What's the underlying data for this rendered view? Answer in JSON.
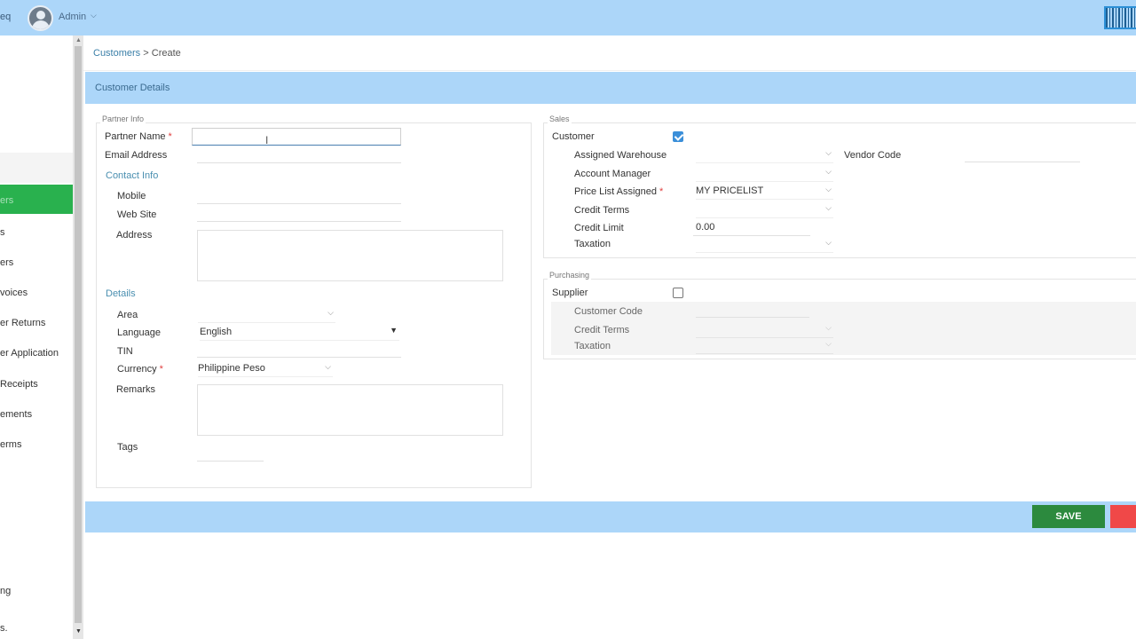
{
  "topbar": {
    "brand_fragment": "eq",
    "user": "Admin",
    "chevron": "⌵"
  },
  "sidebar": {
    "items": [
      {
        "label": "ers",
        "active": true
      },
      {
        "label": "s"
      },
      {
        "label": "ers"
      },
      {
        "label": "voices"
      },
      {
        "label": "er Returns"
      },
      {
        "label": "er Application"
      },
      {
        "label": " Receipts"
      },
      {
        "label": "ements"
      },
      {
        "label": "erms"
      },
      {
        "label": "ng"
      },
      {
        "label": "s."
      }
    ]
  },
  "breadcrumb": {
    "parent": "Customers",
    "separator": ">",
    "current": "Create"
  },
  "panel": {
    "title": "Customer Details"
  },
  "partner_info": {
    "legend": "Partner Info",
    "partner_name": {
      "label": "Partner Name",
      "required": "*",
      "value": ""
    },
    "email": {
      "label": "Email Address",
      "value": ""
    },
    "contact_section": "Contact Info",
    "mobile": {
      "label": "Mobile",
      "value": ""
    },
    "website": {
      "label": "Web Site",
      "value": ""
    },
    "address": {
      "label": "Address"
    },
    "details_section": "Details",
    "area": {
      "label": "Area",
      "value": ""
    },
    "language": {
      "label": "Language",
      "value": "English"
    },
    "tin": {
      "label": "TIN",
      "value": ""
    },
    "currency": {
      "label": "Currency",
      "required": "*",
      "value": "Philippine Peso"
    },
    "remarks": {
      "label": "Remarks"
    },
    "tags": {
      "label": "Tags"
    }
  },
  "sales": {
    "legend": "Sales",
    "customer": {
      "label": "Customer",
      "checked": true
    },
    "assigned_warehouse": {
      "label": "Assigned Warehouse",
      "value": ""
    },
    "vendor_code": {
      "label": "Vendor Code",
      "value": ""
    },
    "account_manager": {
      "label": "Account Manager",
      "value": ""
    },
    "price_list": {
      "label": "Price List Assigned",
      "required": "*",
      "value": "MY PRICELIST"
    },
    "credit_terms": {
      "label": "Credit Terms",
      "value": ""
    },
    "credit_limit": {
      "label": "Credit Limit",
      "value": "0.00"
    },
    "taxation": {
      "label": "Taxation",
      "value": ""
    }
  },
  "purchasing": {
    "legend": "Purchasing",
    "supplier": {
      "label": "Supplier",
      "checked": false
    },
    "customer_code": {
      "label": "Customer Code",
      "value": ""
    },
    "credit_terms": {
      "label": "Credit Terms",
      "value": ""
    },
    "taxation": {
      "label": "Taxation",
      "value": ""
    }
  },
  "actions": {
    "save": "SAVE"
  },
  "colors": {
    "header": "#acd6f9",
    "active_nav": "#29b14e",
    "save": "#2c8a3e",
    "cancel": "#f04848",
    "checkbox": "#3b8fd9"
  }
}
